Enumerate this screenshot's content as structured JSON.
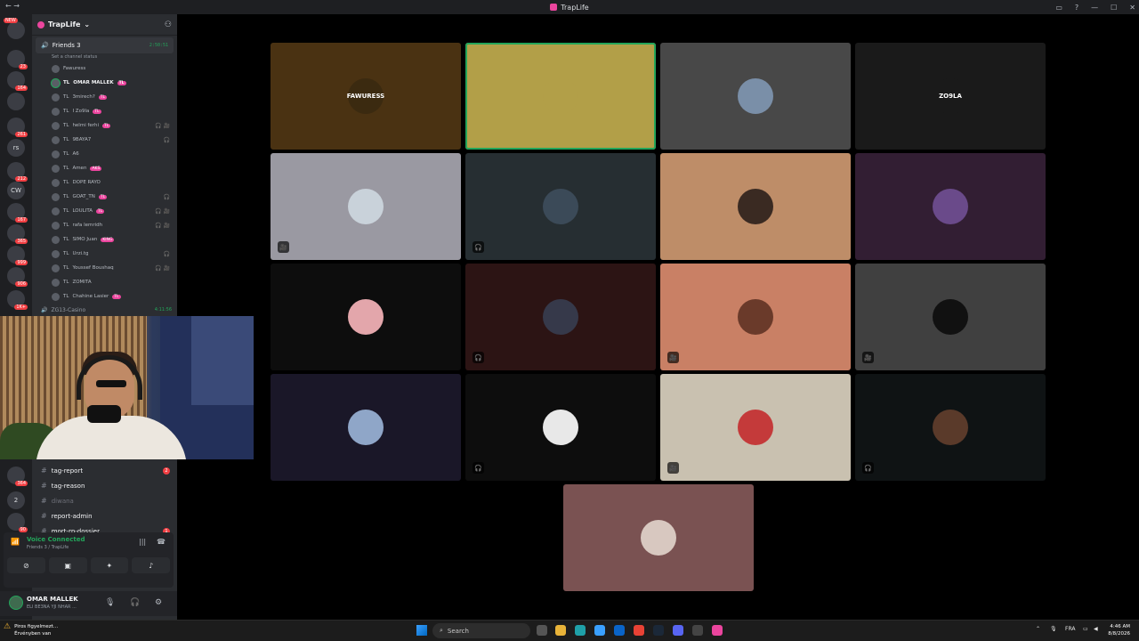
{
  "window": {
    "title": "TrapLife"
  },
  "guild": {
    "name": "TrapLife"
  },
  "voice_channel": {
    "name": "Friends 3",
    "timer": "2:50:51",
    "status_placeholder": "Set a channel status"
  },
  "members": [
    {
      "name": "Fawuress",
      "prefix": "",
      "tag": "",
      "icons": ""
    },
    {
      "name": "OMAR MALLEK",
      "prefix": "TL",
      "tag": "TL",
      "icons": "",
      "highlight": true,
      "speaking": true
    },
    {
      "name": "3mirech?",
      "prefix": "TL",
      "tag": "TL",
      "icons": ""
    },
    {
      "name": "I Zo9la",
      "prefix": "TL",
      "tag": "TL",
      "icons": ""
    },
    {
      "name": "helmi ferhi",
      "prefix": "TL",
      "tag": "TL",
      "icons": "🎧 🎥"
    },
    {
      "name": "9BAYA7",
      "prefix": "TL",
      "tag": "",
      "icons": "🎧"
    },
    {
      "name": "A6",
      "prefix": "TL",
      "tag": "",
      "icons": ""
    },
    {
      "name": "Amen",
      "prefix": "TL",
      "tag": "AKS",
      "icons": ""
    },
    {
      "name": "DOPE RAYO",
      "prefix": "TL",
      "tag": "",
      "icons": ""
    },
    {
      "name": "GOAT_TN",
      "prefix": "TL",
      "tag": "TL",
      "icons": "🎧"
    },
    {
      "name": "LOULITA",
      "prefix": "TL",
      "tag": "TL",
      "icons": "🎧 🎥"
    },
    {
      "name": "rafa lemridh",
      "prefix": "TL",
      "tag": "",
      "icons": "🎧 🎥"
    },
    {
      "name": "SIMO Juan",
      "prefix": "TL",
      "tag": "KING",
      "icons": ""
    },
    {
      "name": "Urzi.tg",
      "prefix": "TL",
      "tag": "",
      "icons": "🎧"
    },
    {
      "name": "Youssef Boushaq",
      "prefix": "TL",
      "tag": "",
      "icons": "🎧 🎥"
    },
    {
      "name": "ZOMITA",
      "prefix": "TL",
      "tag": "",
      "icons": ""
    },
    {
      "name": "Chahine Lasier",
      "prefix": "TL",
      "tag": "TL",
      "icons": ""
    }
  ],
  "voice_channel_2": {
    "name": "ZG13-Casino",
    "timer": "4:11:56"
  },
  "text_channels": [
    {
      "name": "tag-report",
      "badge": "2",
      "muted": false
    },
    {
      "name": "tag-reason",
      "badge": "",
      "muted": false
    },
    {
      "name": "diwana",
      "badge": "",
      "muted": true
    },
    {
      "name": "report-admin",
      "badge": "",
      "muted": false
    },
    {
      "name": "mort-rp-dossier",
      "badge": "1",
      "muted": false
    }
  ],
  "voice_panel": {
    "status": "Voice Connected",
    "channel": "Friends 3 / TrapLife"
  },
  "user": {
    "name": "OMAR MALLEK",
    "status": "ELI BE3NA YJI NHAR ..."
  },
  "servers": [
    {
      "label": "",
      "badge": ""
    },
    {
      "label": "",
      "badge": "23"
    },
    {
      "label": "",
      "badge": "164"
    },
    {
      "label": "",
      "badge": ""
    },
    {
      "label": "",
      "badge": "261"
    },
    {
      "label": "rs",
      "badge": ""
    },
    {
      "label": "",
      "badge": "212"
    },
    {
      "label": "CW",
      "badge": ""
    },
    {
      "label": "",
      "badge": "167"
    },
    {
      "label": "",
      "badge": "365"
    },
    {
      "label": "",
      "badge": "999"
    },
    {
      "label": "",
      "badge": "906"
    },
    {
      "label": "",
      "badge": "1K+"
    },
    {
      "label": "",
      "badge": "364"
    },
    {
      "label": "2",
      "badge": ""
    },
    {
      "label": "",
      "badge": "90"
    }
  ],
  "new_badge": "NEW",
  "tiles": [
    {
      "label": "FAWURESS",
      "bg": "#4a3212",
      "av": "#3b2a10",
      "speaking": false,
      "icon": ""
    },
    {
      "label": "",
      "bg": "#b29f48",
      "av": "#b29f48",
      "speaking": true,
      "icon": ""
    },
    {
      "label": "",
      "bg": "#484848",
      "av": "#7a8fa8",
      "speaking": false,
      "icon": ""
    },
    {
      "label": "ZO9LA",
      "bg": "#1a1a1a",
      "av": "#1a1a1a",
      "speaking": false,
      "icon": ""
    },
    {
      "label": "",
      "bg": "#9a99a2",
      "av": "#c9d2da",
      "speaking": false,
      "icon": "🎥"
    },
    {
      "label": "",
      "bg": "#262e32",
      "av": "#3b4a58",
      "speaking": false,
      "icon": "🎧"
    },
    {
      "label": "",
      "bg": "#be8d68",
      "av": "#3a2a22",
      "speaking": false,
      "icon": ""
    },
    {
      "label": "",
      "bg": "#321e33",
      "av": "#6a4a8a",
      "speaking": false,
      "icon": ""
    },
    {
      "label": "",
      "bg": "#0d0d0d",
      "av": "#e3a6ab",
      "speaking": false,
      "icon": ""
    },
    {
      "label": "",
      "bg": "#2c1414",
      "av": "#36394a",
      "speaking": false,
      "icon": "🎧"
    },
    {
      "label": "",
      "bg": "#c98065",
      "av": "#6a3a2a",
      "speaking": false,
      "icon": "🎥"
    },
    {
      "label": "",
      "bg": "#404040",
      "av": "#111111",
      "speaking": false,
      "icon": "🎥"
    },
    {
      "label": "",
      "bg": "#1a1728",
      "av": "#8fa6c8",
      "speaking": false,
      "icon": ""
    },
    {
      "label": "",
      "bg": "#0d0d0d",
      "av": "#e8e8e8",
      "speaking": false,
      "icon": "🎧"
    },
    {
      "label": "",
      "bg": "#c9c1b0",
      "av": "#c43a3a",
      "speaking": false,
      "icon": "🎥"
    },
    {
      "label": "",
      "bg": "#0f1314",
      "av": "#5a3a2a",
      "speaking": false,
      "icon": "🎧"
    },
    {
      "label": "",
      "bg": "#7a5252",
      "av": "#d8c8c0",
      "speaking": false,
      "icon": ""
    }
  ],
  "taskbar": {
    "notification_title": "Piros figyelmezt...",
    "notification_sub": "Érvényben van",
    "search": "Search",
    "lang": "FRA",
    "time": "4:46 AM",
    "date": "8/8/2026"
  }
}
